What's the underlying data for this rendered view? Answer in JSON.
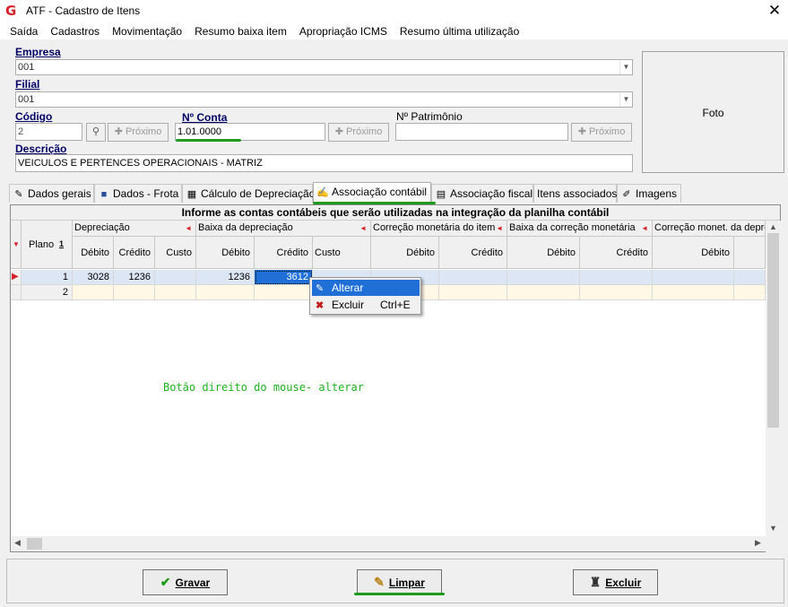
{
  "window": {
    "title": "ATF - Cadastro de Itens",
    "close_glyph": "✕"
  },
  "menu": [
    "Saída",
    "Cadastros",
    "Movimentação",
    "Resumo baixa item",
    "Apropriação ICMS",
    "Resumo última utilização"
  ],
  "form": {
    "empresa_label": "Empresa",
    "empresa_value": "001",
    "filial_label": "Filial",
    "filial_value": "001",
    "codigo_label": "Código",
    "codigo_value": "2",
    "proximo_label": "Próximo",
    "nconta_label": "Nº Conta",
    "nconta_value": "1.01.0000",
    "npatrimonio_label": "Nº Patrimônio",
    "npatrimonio_value": "",
    "descricao_label": "Descrição",
    "descricao_value": "VEICULOS E PERTENCES OPERACIONAIS - MATRIZ",
    "foto_label": "Foto"
  },
  "tabs": [
    {
      "label": "Dados gerais",
      "icon": "pencil-icon"
    },
    {
      "label": "Dados - Frota",
      "icon": "car-icon"
    },
    {
      "label": "Cálculo de Depreciação",
      "icon": "calculator-icon"
    },
    {
      "label": "Associação contábil",
      "icon": "edit-form-icon",
      "active": true
    },
    {
      "label": "Associação fiscal",
      "icon": "document-icon"
    },
    {
      "label": "Itens associados",
      "icon": ""
    },
    {
      "label": "Imagens",
      "icon": "brushes-icon"
    }
  ],
  "grid": {
    "caption": "Informe as contas contábeis que serão utilizadas na integração da planilha contábil",
    "plano_header": "Plano",
    "sort_badge": "1",
    "groups": [
      "Depreciação",
      "Baixa da depreciação",
      "Correção monetária do item",
      "Baixa da correção monetária",
      "Correção monet. da depre"
    ],
    "cols": [
      "Débito",
      "Crédito",
      "Custo",
      "Débito",
      "Crédito",
      "Custo",
      "Débito",
      "Crédito",
      "Débito",
      "Crédito",
      "Débito"
    ],
    "rows": [
      {
        "plano": "1",
        "values": [
          "3028",
          "1236",
          "",
          "1236",
          "3612",
          "",
          "",
          "",
          "",
          "",
          ""
        ]
      },
      {
        "plano": "2",
        "values": [
          "",
          "",
          "",
          "",
          "",
          "",
          "",
          "",
          "",
          "",
          ""
        ]
      }
    ]
  },
  "context_menu": [
    {
      "label": "Alterar",
      "shortcut": "",
      "icon": "pencil-icon"
    },
    {
      "label": "Excluir",
      "shortcut": "Ctrl+E",
      "icon": "delete-icon"
    }
  ],
  "annotation": "Botão direito do mouse- alterar",
  "buttons": {
    "gravar": "Gravar",
    "limpar": "Limpar",
    "excluir": "Excluir"
  },
  "colors": {
    "accent_red": "#d6202a",
    "highlight": "#1f6fd6",
    "annotation_green": "#1eb31e"
  }
}
